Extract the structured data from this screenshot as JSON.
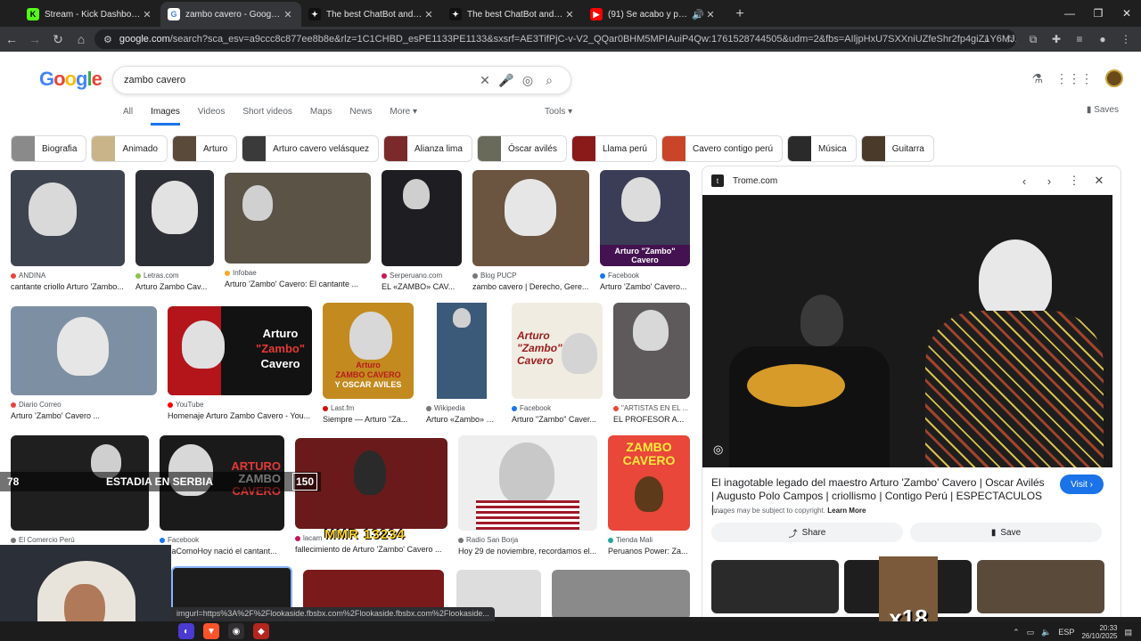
{
  "browser": {
    "tabs": [
      {
        "title": "Stream - Kick Dashboard",
        "favicon": "kick-icon",
        "color": "#53fc18"
      },
      {
        "title": "zambo cavero - Google Search",
        "favicon": "google-icon",
        "color": "#4285f4"
      },
      {
        "title": "The best ChatBot and Widgets",
        "favicon": "chatbot-icon",
        "color": "#111111"
      },
      {
        "title": "The best ChatBot and Widgets",
        "favicon": "chatbot-icon",
        "color": "#111111"
      },
      {
        "title": "(91) Se acabo y punto - Za",
        "favicon": "youtube-icon",
        "color": "#ff0000"
      }
    ],
    "url_domain": "google.com",
    "url_rest": "/search?sca_esv=a9ccc8c877ee8b8e&rlz=1C1CHBD_esPE1133PE1133&sxsrf=AE3TifPjC-v-V2_QQar0BHM5MPIAuiP4Qw:1761528744505&udm=2&fbs=AIljpHxU7SXXniUZfeShr2fp4giZ1Y6MJ25_tmWITc7uy4KIeoJTKjrFjVxy..."
  },
  "search": {
    "query": "zambo cavero",
    "tabs": [
      "All",
      "Images",
      "Videos",
      "Short videos",
      "Maps",
      "News",
      "More"
    ],
    "tools": "Tools",
    "saves": "Saves"
  },
  "chips": [
    "Biografia",
    "Animado",
    "Arturo",
    "Arturo cavero velásquez",
    "Alianza lima",
    "Óscar avilés",
    "Llama perú",
    "Cavero contigo perú",
    "Música",
    "Guitarra"
  ],
  "results": [
    {
      "source": "ANDINA",
      "caption": "cantante criollo Arturo 'Zambo...",
      "dot": "#e8453c"
    },
    {
      "source": "Letras.com",
      "caption": "Arturo Zambo Cav...",
      "dot": "#8bc34a"
    },
    {
      "source": "Infobae",
      "caption": "Arturo 'Zambo' Cavero: El cantante ...",
      "dot": "#f9a825"
    },
    {
      "source": "Serperuano.com",
      "caption": "EL «ZAMBO» CAV...",
      "dot": "#c2185b"
    },
    {
      "source": "Blog PUCP",
      "caption": "zambo cavero | Derecho, Gere...",
      "dot": "#777777"
    },
    {
      "source": "Facebook",
      "caption": "Arturo 'Zambo' Cavero...",
      "dot": "#1877f2",
      "overlay": "Arturo \"Zambo\" Cavero"
    },
    {
      "source": "Diario Correo",
      "caption": "Arturo 'Zambo' Cavero ...",
      "dot": "#e8453c"
    },
    {
      "source": "YouTube",
      "caption": "Homenaje Arturo Zambo Cavero - You...",
      "dot": "#ff0000"
    },
    {
      "source": "Last.fm",
      "caption": "Siempre — Arturo \"Za...",
      "dot": "#d51007"
    },
    {
      "source": "Wikipedia",
      "caption": "Arturo «Zambo» C...",
      "dot": "#777777"
    },
    {
      "source": "Facebook",
      "caption": "Arturo \"Zambo\" Caver...",
      "dot": "#1877f2"
    },
    {
      "source": "\"ARTISTAS EN EL ...",
      "caption": "EL PROFESOR A...",
      "dot": "#e8453c"
    },
    {
      "source": "El Comercio Perú",
      "caption": "",
      "dot": "#777777"
    },
    {
      "source": "Facebook",
      "caption": "hDiaComoHoy nació el cantant...",
      "dot": "#1877f2"
    },
    {
      "source": "lacam",
      "caption": "fallecimiento de Arturo 'Zambo' Cavero ...",
      "dot": "#c2185b"
    },
    {
      "source": "Radio San Borja",
      "caption": "Hoy 29 de noviembre, recordamos el...",
      "dot": "#777777"
    },
    {
      "source": "Tienda Mali",
      "caption": "Peruanos Power: Za...",
      "dot": "#26a69a"
    }
  ],
  "stream_overlay": {
    "left_num": "78",
    "text": "ESTADIA EN SERBIA",
    "right_num": "150",
    "mmr": "MMR 13234",
    "multiplier": "x18"
  },
  "preview": {
    "site": "Trome.com",
    "title": "El inagotable legado del maestro Arturo 'Zambo' Cavero | Oscar Avilés | Augusto Polo Campos | criollismo | Contigo Perú | ESPECTACULOS |...",
    "visit": "Visit",
    "copyright": "Images may be subject to copyright.",
    "learn_more": "Learn More",
    "share": "Share",
    "save": "Save"
  },
  "status_url": "imgurl=https%3A%2F%2Flookaside.fbsbx.com%2Flookaside.fbsbx.com%2Flookaside...",
  "taskbar": {
    "lang": "ESP",
    "time": "20:33",
    "date": "26/10/2025"
  }
}
